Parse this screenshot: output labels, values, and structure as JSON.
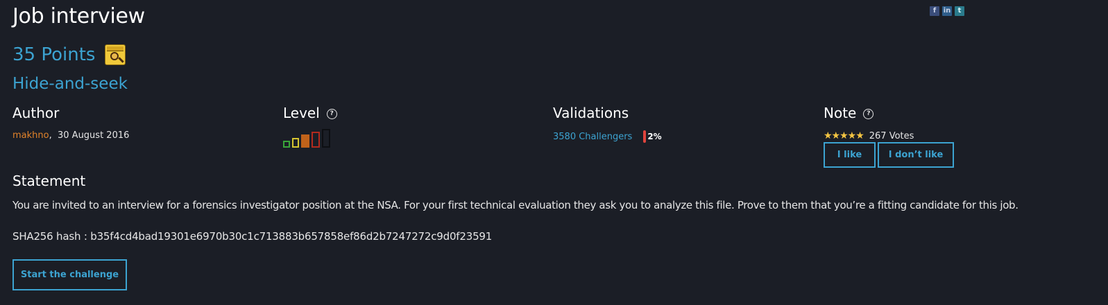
{
  "challenge": {
    "title": "Job interview",
    "points": "35 Points",
    "category": "Hide-and-seek"
  },
  "share": {
    "facebook_icon": "f",
    "linkedin_icon": "in",
    "twitter_icon": "t"
  },
  "author": {
    "heading": "Author",
    "name": "makhno",
    "separator": ",",
    "date": "30 August 2016"
  },
  "level": {
    "heading": "Level",
    "help_glyph": "?",
    "value": 3,
    "max": 5,
    "colors": [
      "#3aa53a",
      "#d6c530",
      "#c0621a",
      "#b32a1e",
      "#0d0f13"
    ]
  },
  "validations": {
    "heading": "Validations",
    "challengers": "3580 Challengers",
    "percent": "2%"
  },
  "note": {
    "heading": "Note",
    "help_glyph": "?",
    "stars": "★★★★★",
    "rating": 5,
    "votes": "267 Votes",
    "like_label": "I like",
    "dislike_label": "I don’t like"
  },
  "statement": {
    "heading": "Statement",
    "text": "You are invited to an interview for a forensics investigator position at the NSA. For your first technical evaluation they ask you to analyze this file. Prove to them that you’re a fitting candidate for this job.",
    "hash": "SHA256 hash : b35f4cd4bad19301e6970b30c1c713883b657858ef86d2b7247272c9d0f23591"
  },
  "actions": {
    "start_label": "Start the challenge"
  },
  "colors": {
    "background": "#1b1e26",
    "accent": "#3ca3d1",
    "author_link": "#e2832a",
    "stars": "#f4c542",
    "validation_bar": "#e0443d"
  }
}
